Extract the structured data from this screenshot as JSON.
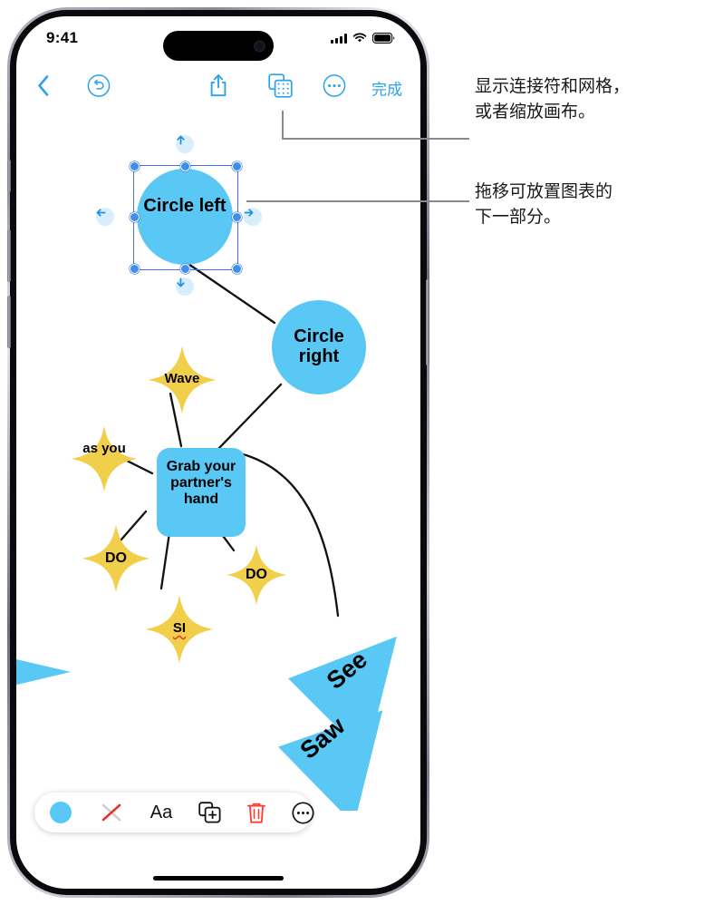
{
  "status_bar": {
    "time": "9:41",
    "cellular_icon": "cellular-bars-icon",
    "wifi_icon": "wifi-icon",
    "battery_icon": "battery-icon"
  },
  "top_toolbar": {
    "back_icon": "chevron-left-icon",
    "undo_icon": "undo-circle-icon",
    "share_icon": "share-icon",
    "grid_icon": "grid-layers-icon",
    "more_icon": "more-circle-icon",
    "done_label": "完成"
  },
  "bottom_toolbar": {
    "fill_icon": "fill-color-swatch",
    "fill_color": "#5AC8F5",
    "no_stroke_icon": "no-stroke-icon",
    "text_label": "Aa",
    "duplicate_icon": "duplicate-icon",
    "delete_icon": "trash-icon",
    "delete_color": "#FF3B30",
    "more_icon": "more-circle-icon"
  },
  "colors": {
    "blue_shape": "#5AC8F5",
    "yellow_shape": "#F2CF4A",
    "accent": "#2AA3EE",
    "selection": "#3F72E8",
    "connector": "#111111"
  },
  "canvas": {
    "selected_node": {
      "label": "Circle left",
      "shape": "circle",
      "color": "#5AC8F5",
      "handles": 8,
      "arrow_buttons": [
        "arrow-up-button",
        "arrow-right-button",
        "arrow-down-button",
        "arrow-left-button"
      ]
    },
    "nodes": [
      {
        "id": "circle-left",
        "label": "Circle left",
        "shape": "circle",
        "color": "#5AC8F5"
      },
      {
        "id": "circle-right",
        "label": "Circle right",
        "shape": "circle",
        "color": "#5AC8F5"
      },
      {
        "id": "wave",
        "label": "Wave",
        "shape": "four-point-star",
        "color": "#F2CF4A"
      },
      {
        "id": "as-you",
        "label": "as you",
        "shape": "four-point-star",
        "color": "#F2CF4A"
      },
      {
        "id": "grab",
        "label": "Grab your partner's hand",
        "shape": "rounded-rect",
        "color": "#5AC8F5"
      },
      {
        "id": "do-left",
        "label": "DO",
        "shape": "four-point-star",
        "color": "#F2CF4A"
      },
      {
        "id": "do-right",
        "label": "DO",
        "shape": "four-point-star",
        "color": "#F2CF4A"
      },
      {
        "id": "si",
        "label": "SI",
        "shape": "four-point-star",
        "color": "#F2CF4A",
        "misspelled": true
      },
      {
        "id": "see",
        "label": "See",
        "shape": "triangle",
        "color": "#5AC8F5"
      },
      {
        "id": "saw",
        "label": "Saw",
        "shape": "triangle",
        "color": "#5AC8F5"
      }
    ],
    "connections": [
      [
        "circle-left",
        "circle-right"
      ],
      [
        "circle-right",
        "grab"
      ],
      [
        "wave",
        "grab"
      ],
      [
        "as-you",
        "grab"
      ],
      [
        "grab",
        "do-left"
      ],
      [
        "grab",
        "si"
      ],
      [
        "grab",
        "do-right"
      ],
      [
        "grab",
        "see"
      ],
      [
        "see",
        "saw"
      ]
    ]
  },
  "callouts": [
    {
      "id": "callout-grid",
      "text": "显示连接符和网格，\n或者缩放画布。"
    },
    {
      "id": "callout-arrow",
      "text": "拖移可放置图表的\n下一部分。"
    }
  ]
}
